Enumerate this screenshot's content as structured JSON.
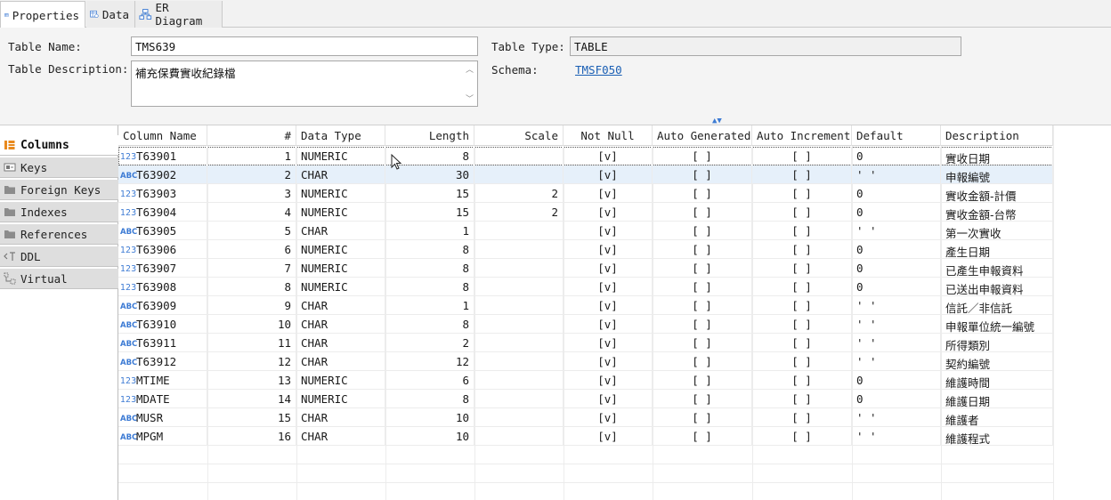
{
  "tabs": [
    {
      "label": "Properties",
      "icon": "table-properties-icon",
      "active": true
    },
    {
      "label": "Data",
      "icon": "table-data-icon",
      "active": false
    },
    {
      "label": "ER Diagram",
      "icon": "er-diagram-icon",
      "active": false
    }
  ],
  "form": {
    "table_name_label": "Table Name:",
    "table_name_value": "TMS639",
    "table_description_label": "Table Description:",
    "table_description_value": "補充保費實收紀錄檔",
    "table_type_label": "Table Type:",
    "table_type_value": "TABLE",
    "schema_label": "Schema:",
    "schema_value": "TMSF050"
  },
  "side_tabs": [
    {
      "label": "Columns",
      "icon": "columns-icon",
      "active": true
    },
    {
      "label": "Keys",
      "icon": "key-icon",
      "active": false
    },
    {
      "label": "Foreign Keys",
      "icon": "folder-icon",
      "active": false
    },
    {
      "label": "Indexes",
      "icon": "folder-icon",
      "active": false
    },
    {
      "label": "References",
      "icon": "folder-icon",
      "active": false
    },
    {
      "label": "DDL",
      "icon": "ddl-icon",
      "active": false
    },
    {
      "label": "Virtual",
      "icon": "virtual-icon",
      "active": false
    }
  ],
  "grid": {
    "headers": [
      "Column Name",
      "#",
      "Data Type",
      "Length",
      "Scale",
      "Not Null",
      "Auto Generated",
      "Auto Increment",
      "Default",
      "Description"
    ],
    "rows": [
      {
        "kind": "123",
        "name": "T63901",
        "num": "1",
        "type": "NUMERIC",
        "length": "8",
        "scale": "",
        "not_null": "[v]",
        "auto_gen": "[ ]",
        "auto_inc": "[ ]",
        "default": "0",
        "desc": "實收日期"
      },
      {
        "kind": "ABC",
        "name": "T63902",
        "num": "2",
        "type": "CHAR",
        "length": "30",
        "scale": "",
        "not_null": "[v]",
        "auto_gen": "[ ]",
        "auto_inc": "[ ]",
        "default": "' '",
        "desc": "申報編號"
      },
      {
        "kind": "123",
        "name": "T63903",
        "num": "3",
        "type": "NUMERIC",
        "length": "15",
        "scale": "2",
        "not_null": "[v]",
        "auto_gen": "[ ]",
        "auto_inc": "[ ]",
        "default": "0",
        "desc": "實收金額-計價"
      },
      {
        "kind": "123",
        "name": "T63904",
        "num": "4",
        "type": "NUMERIC",
        "length": "15",
        "scale": "2",
        "not_null": "[v]",
        "auto_gen": "[ ]",
        "auto_inc": "[ ]",
        "default": "0",
        "desc": "實收金額-台幣"
      },
      {
        "kind": "ABC",
        "name": "T63905",
        "num": "5",
        "type": "CHAR",
        "length": "1",
        "scale": "",
        "not_null": "[v]",
        "auto_gen": "[ ]",
        "auto_inc": "[ ]",
        "default": "' '",
        "desc": "第一次實收"
      },
      {
        "kind": "123",
        "name": "T63906",
        "num": "6",
        "type": "NUMERIC",
        "length": "8",
        "scale": "",
        "not_null": "[v]",
        "auto_gen": "[ ]",
        "auto_inc": "[ ]",
        "default": "0",
        "desc": "產生日期"
      },
      {
        "kind": "123",
        "name": "T63907",
        "num": "7",
        "type": "NUMERIC",
        "length": "8",
        "scale": "",
        "not_null": "[v]",
        "auto_gen": "[ ]",
        "auto_inc": "[ ]",
        "default": "0",
        "desc": "已產生申報資料"
      },
      {
        "kind": "123",
        "name": "T63908",
        "num": "8",
        "type": "NUMERIC",
        "length": "8",
        "scale": "",
        "not_null": "[v]",
        "auto_gen": "[ ]",
        "auto_inc": "[ ]",
        "default": "0",
        "desc": "已送出申報資料"
      },
      {
        "kind": "ABC",
        "name": "T63909",
        "num": "9",
        "type": "CHAR",
        "length": "1",
        "scale": "",
        "not_null": "[v]",
        "auto_gen": "[ ]",
        "auto_inc": "[ ]",
        "default": "' '",
        "desc": "信託／非信託"
      },
      {
        "kind": "ABC",
        "name": "T63910",
        "num": "10",
        "type": "CHAR",
        "length": "8",
        "scale": "",
        "not_null": "[v]",
        "auto_gen": "[ ]",
        "auto_inc": "[ ]",
        "default": "' '",
        "desc": "申報單位統一編號"
      },
      {
        "kind": "ABC",
        "name": "T63911",
        "num": "11",
        "type": "CHAR",
        "length": "2",
        "scale": "",
        "not_null": "[v]",
        "auto_gen": "[ ]",
        "auto_inc": "[ ]",
        "default": "' '",
        "desc": "所得類別"
      },
      {
        "kind": "ABC",
        "name": "T63912",
        "num": "12",
        "type": "CHAR",
        "length": "12",
        "scale": "",
        "not_null": "[v]",
        "auto_gen": "[ ]",
        "auto_inc": "[ ]",
        "default": "' '",
        "desc": "契約編號"
      },
      {
        "kind": "123",
        "name": "MTIME",
        "num": "13",
        "type": "NUMERIC",
        "length": "6",
        "scale": "",
        "not_null": "[v]",
        "auto_gen": "[ ]",
        "auto_inc": "[ ]",
        "default": "0",
        "desc": "維護時間"
      },
      {
        "kind": "123",
        "name": "MDATE",
        "num": "14",
        "type": "NUMERIC",
        "length": "8",
        "scale": "",
        "not_null": "[v]",
        "auto_gen": "[ ]",
        "auto_inc": "[ ]",
        "default": "0",
        "desc": "維護日期"
      },
      {
        "kind": "ABC",
        "name": "MUSR",
        "num": "15",
        "type": "CHAR",
        "length": "10",
        "scale": "",
        "not_null": "[v]",
        "auto_gen": "[ ]",
        "auto_inc": "[ ]",
        "default": "' '",
        "desc": "維護者"
      },
      {
        "kind": "ABC",
        "name": "MPGM",
        "num": "16",
        "type": "CHAR",
        "length": "10",
        "scale": "",
        "not_null": "[v]",
        "auto_gen": "[ ]",
        "auto_inc": "[ ]",
        "default": "' '",
        "desc": "維護程式"
      }
    ],
    "selected_row": 2
  }
}
